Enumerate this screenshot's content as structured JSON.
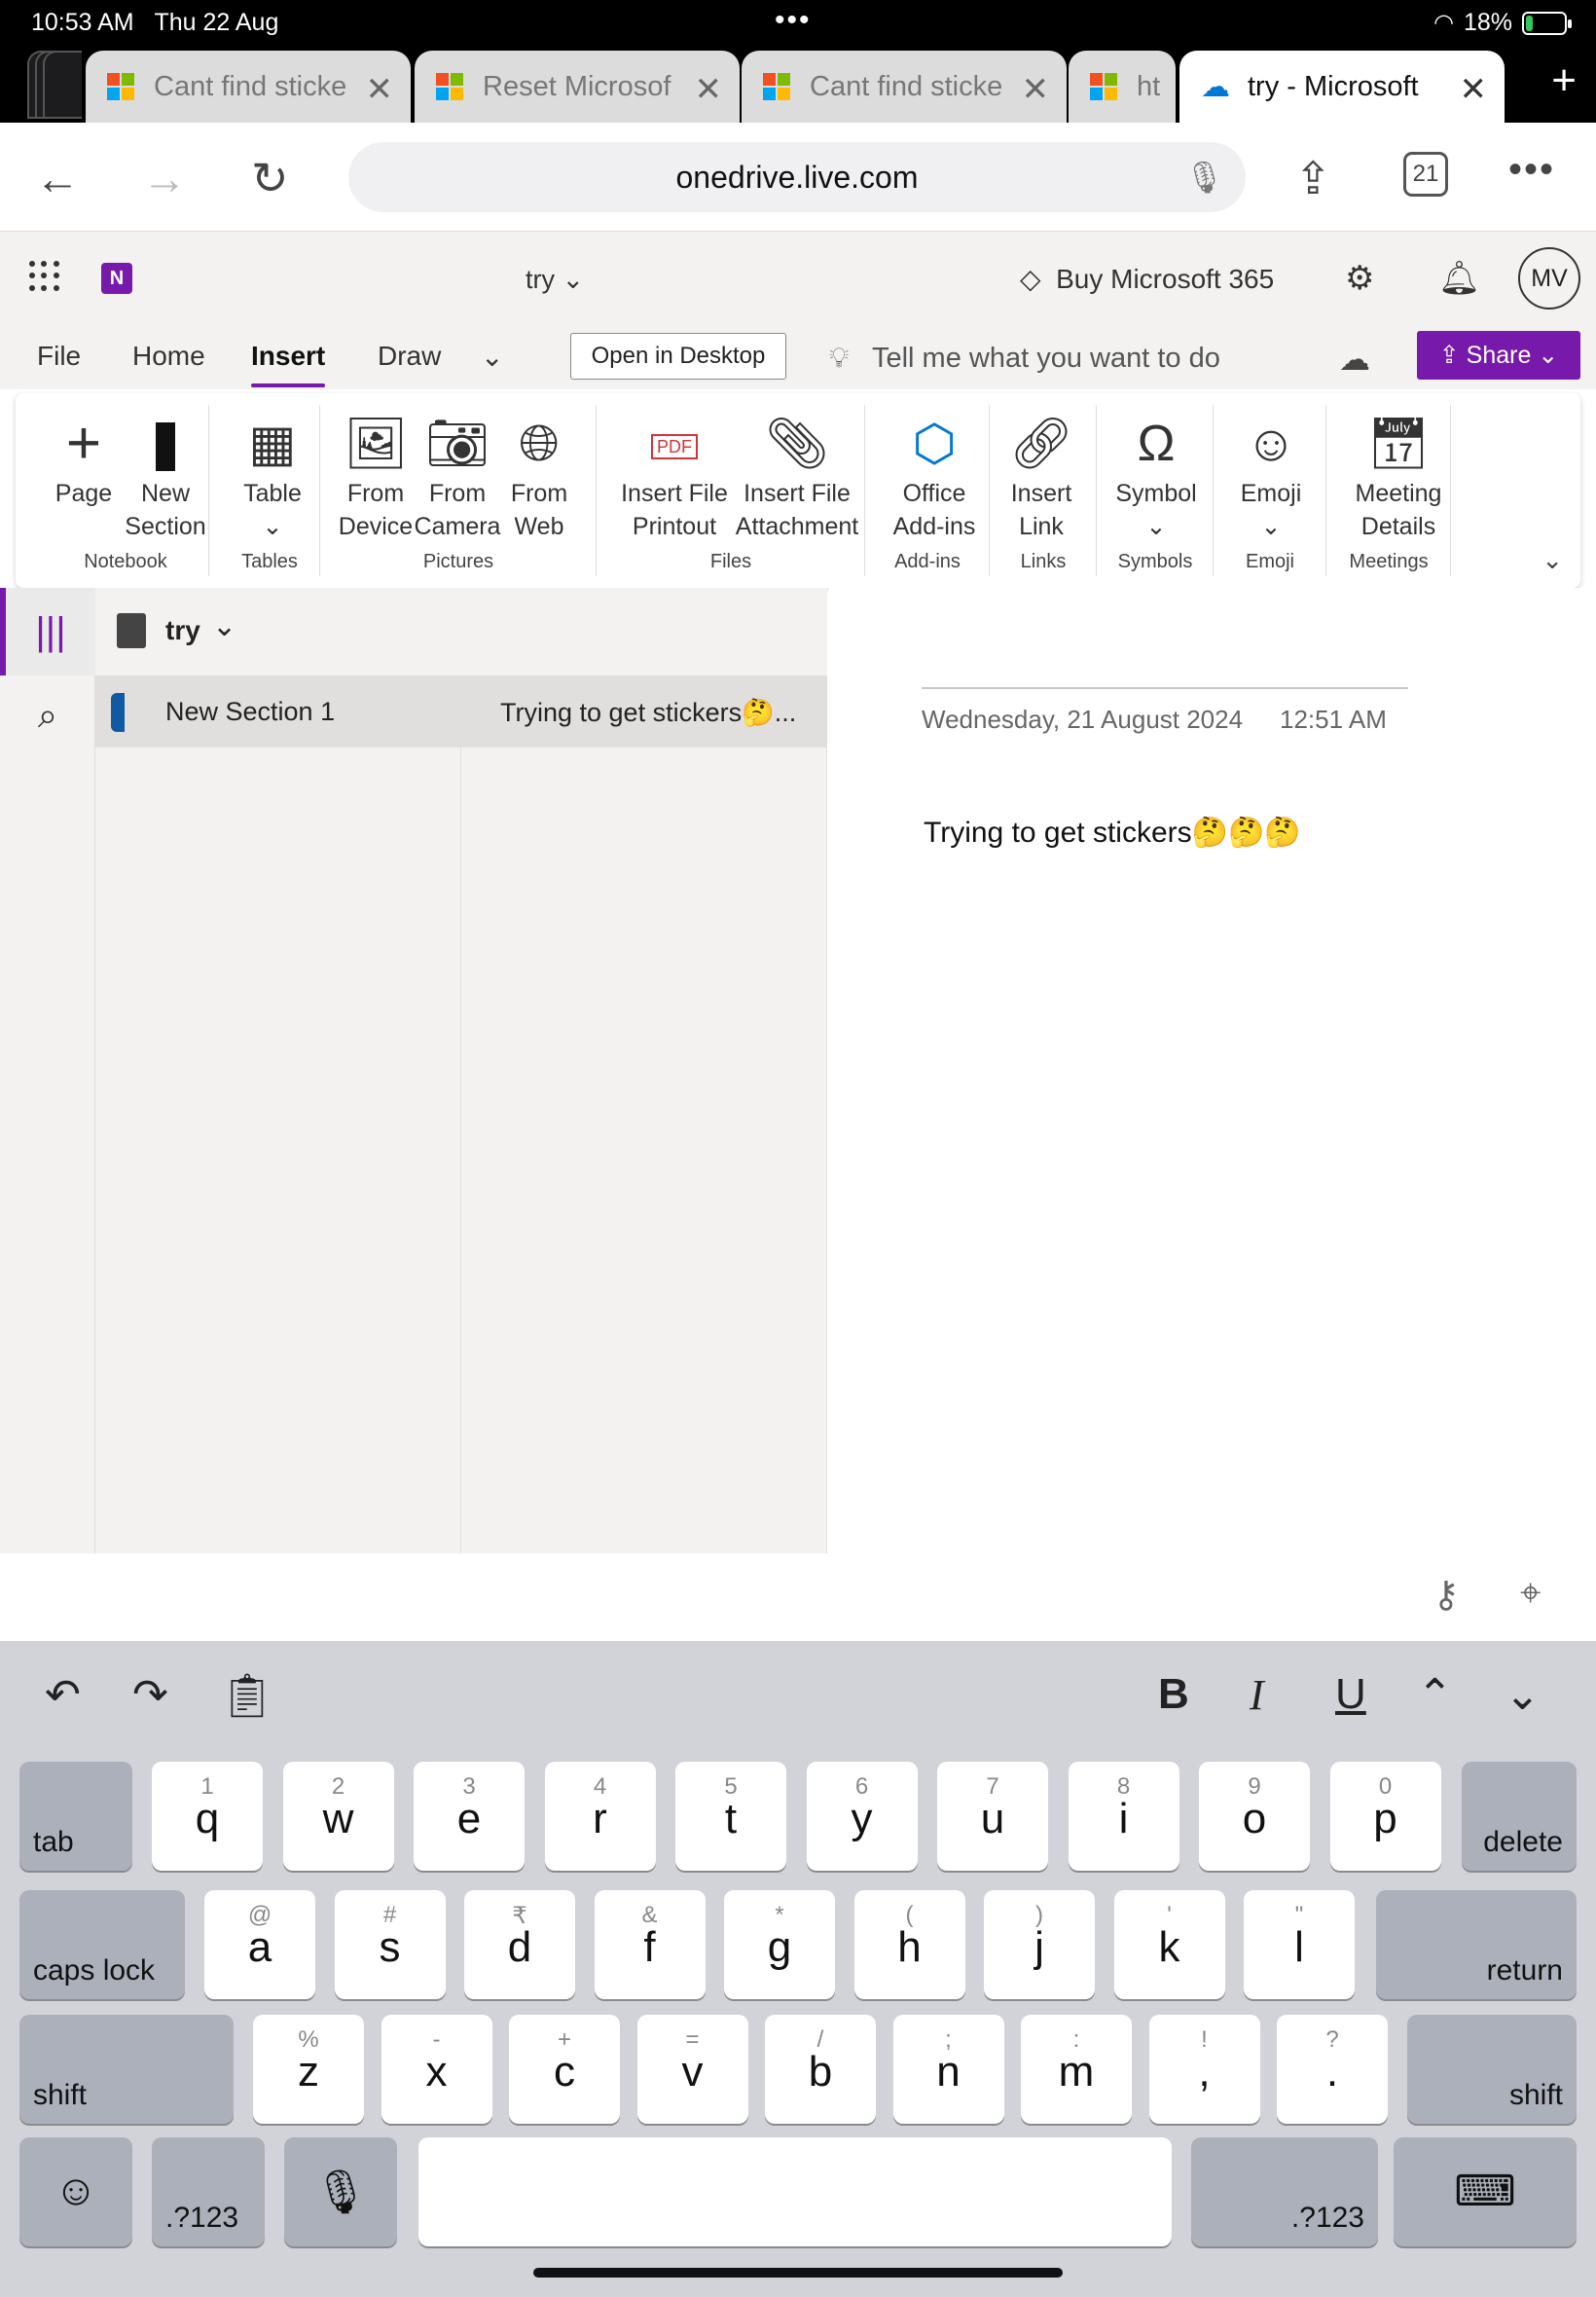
{
  "status_bar": {
    "time": "10:53 AM",
    "date": "Thu 22 Aug",
    "battery": "18%",
    "battery_level": 0.18
  },
  "browser": {
    "tabs": [
      {
        "label": "Cant find sticke"
      },
      {
        "label": "Reset Microsof"
      },
      {
        "label": "Cant find sticke"
      },
      {
        "label": "ht"
      },
      {
        "label": "try - Microsoft"
      }
    ],
    "url": "onedrive.live.com",
    "tab_count": "21"
  },
  "app": {
    "doc_title": "try",
    "buy_label": "Buy Microsoft 365",
    "avatar_initials": "MV",
    "logo_letter": "N"
  },
  "ribbon_tabs": {
    "file": "File",
    "home": "Home",
    "insert": "Insert",
    "draw": "Draw",
    "open_desktop": "Open in Desktop",
    "tell_me": "Tell me what you want to do",
    "share": "Share"
  },
  "ribbon": {
    "buttons": [
      {
        "line1": "Page",
        "line2": ""
      },
      {
        "line1": "New",
        "line2": "Section"
      },
      {
        "line1": "Table",
        "line2": "⌄"
      },
      {
        "line1": "From",
        "line2": "Device"
      },
      {
        "line1": "From",
        "line2": "Camera"
      },
      {
        "line1": "From",
        "line2": "Web"
      },
      {
        "line1": "Insert File",
        "line2": "Printout"
      },
      {
        "line1": "Insert File",
        "line2": "Attachment"
      },
      {
        "line1": "Office",
        "line2": "Add-ins"
      },
      {
        "line1": "Insert",
        "line2": "Link"
      },
      {
        "line1": "Symbol",
        "line2": "⌄"
      },
      {
        "line1": "Emoji",
        "line2": "⌄"
      },
      {
        "line1": "Meeting",
        "line2": "Details"
      }
    ],
    "groups": [
      "Notebook",
      "Tables",
      "Pictures",
      "Files",
      "Add-ins",
      "Links",
      "Symbols",
      "Emoji",
      "Meetings"
    ],
    "pdf_label": "PDF"
  },
  "navigation": {
    "notebook_name": "try",
    "section": "New Section 1",
    "page": "Trying to get stickers🤔..."
  },
  "page": {
    "date": "Wednesday, 21 August 2024",
    "time": "12:51 AM",
    "content": "Trying to get stickers🤔🤔🤔"
  },
  "keyboard": {
    "row1": [
      {
        "hint": "1",
        "key": "q"
      },
      {
        "hint": "2",
        "key": "w"
      },
      {
        "hint": "3",
        "key": "e"
      },
      {
        "hint": "4",
        "key": "r"
      },
      {
        "hint": "5",
        "key": "t"
      },
      {
        "hint": "6",
        "key": "y"
      },
      {
        "hint": "7",
        "key": "u"
      },
      {
        "hint": "8",
        "key": "i"
      },
      {
        "hint": "9",
        "key": "o"
      },
      {
        "hint": "0",
        "key": "p"
      }
    ],
    "row2": [
      {
        "hint": "@",
        "key": "a"
      },
      {
        "hint": "#",
        "key": "s"
      },
      {
        "hint": "₹",
        "key": "d"
      },
      {
        "hint": "&",
        "key": "f"
      },
      {
        "hint": "*",
        "key": "g"
      },
      {
        "hint": "(",
        "key": "h"
      },
      {
        "hint": ")",
        "key": "j"
      },
      {
        "hint": "'",
        "key": "k"
      },
      {
        "hint": "\"",
        "key": "l"
      }
    ],
    "row3": [
      {
        "hint": "%",
        "key": "z"
      },
      {
        "hint": "-",
        "key": "x"
      },
      {
        "hint": "+",
        "key": "c"
      },
      {
        "hint": "=",
        "key": "v"
      },
      {
        "hint": "/",
        "key": "b"
      },
      {
        "hint": ";",
        "key": "n"
      },
      {
        "hint": ":",
        "key": "m"
      },
      {
        "hint": "!",
        "key": ","
      },
      {
        "hint": "?",
        "key": "."
      }
    ],
    "tab": "tab",
    "delete": "delete",
    "caps_lock": "caps lock",
    "return": "return",
    "shift": "shift",
    "numbers": ".?123"
  },
  "colors": {
    "brand_purple": "#7719aa",
    "section_blue": "#0f5aa3"
  },
  "icons": [
    "wifi-icon",
    "battery-icon",
    "back-icon",
    "forward-icon",
    "reload-icon",
    "microphone-icon",
    "share-icon",
    "more-icon",
    "waffle-icon",
    "onenote-logo-icon",
    "diamond-icon",
    "gear-icon",
    "bell-icon",
    "lightbulb-icon",
    "cloud-sync-icon",
    "key-icon",
    "location-pin-icon",
    "undo-icon",
    "redo-icon",
    "paste-icon",
    "bold-icon",
    "italic-icon",
    "underline-icon",
    "emoji-icon",
    "keyboard-hide-icon"
  ]
}
